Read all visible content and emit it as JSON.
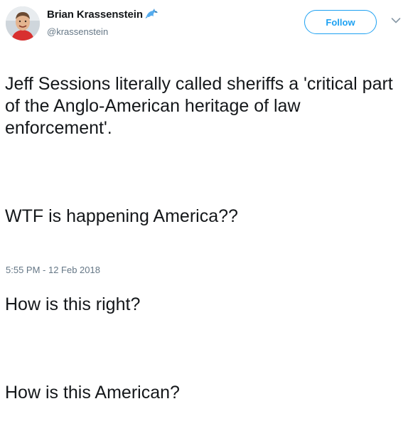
{
  "author": {
    "display_name": "Brian Krassenstein",
    "handle": "@krassenstein",
    "name_emoji": "dolphin-icon"
  },
  "follow_button": {
    "label": "Follow"
  },
  "menu": {
    "icon": "chevron-down-icon"
  },
  "tweet": {
    "paragraphs": [
      "Jeff Sessions literally called sheriffs a 'critical part of the Anglo-American heritage of law enforcement'.",
      "WTF is happening America??",
      "How is this right?",
      "How is this American?"
    ],
    "timestamp": "5:55 PM - 12 Feb 2018"
  },
  "colors": {
    "accent": "#1da1f2",
    "text": "#14171a",
    "secondary": "#657786"
  }
}
